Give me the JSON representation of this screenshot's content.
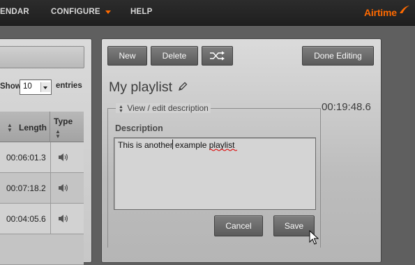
{
  "nav": {
    "items": [
      "ENDAR",
      "CONFIGURE",
      "HELP"
    ],
    "brand": "Airtime",
    "accent": "#ff6a00"
  },
  "library": {
    "show_label": "Show",
    "page_size": "10",
    "entries_label": "entries",
    "columns": [
      "Length",
      "Type"
    ],
    "rows": [
      {
        "length": "00:06:01.3",
        "type_icon": "speaker-icon"
      },
      {
        "length": "00:07:18.2",
        "type_icon": "speaker-icon"
      },
      {
        "length": "00:04:05.6",
        "type_icon": "speaker-icon"
      }
    ]
  },
  "editor": {
    "toolbar": {
      "new_label": "New",
      "delete_label": "Delete",
      "shuffle_icon": "shuffle-icon",
      "done_label": "Done Editing"
    },
    "playlist_title": "My playlist",
    "duration": "00:19:48.6",
    "description": {
      "legend": "View / edit description",
      "label": "Description",
      "text_before_caret": "This is another",
      "text_after_caret": " example playlist",
      "misspelled_word": "playlist",
      "cancel_label": "Cancel",
      "save_label": "Save"
    }
  }
}
